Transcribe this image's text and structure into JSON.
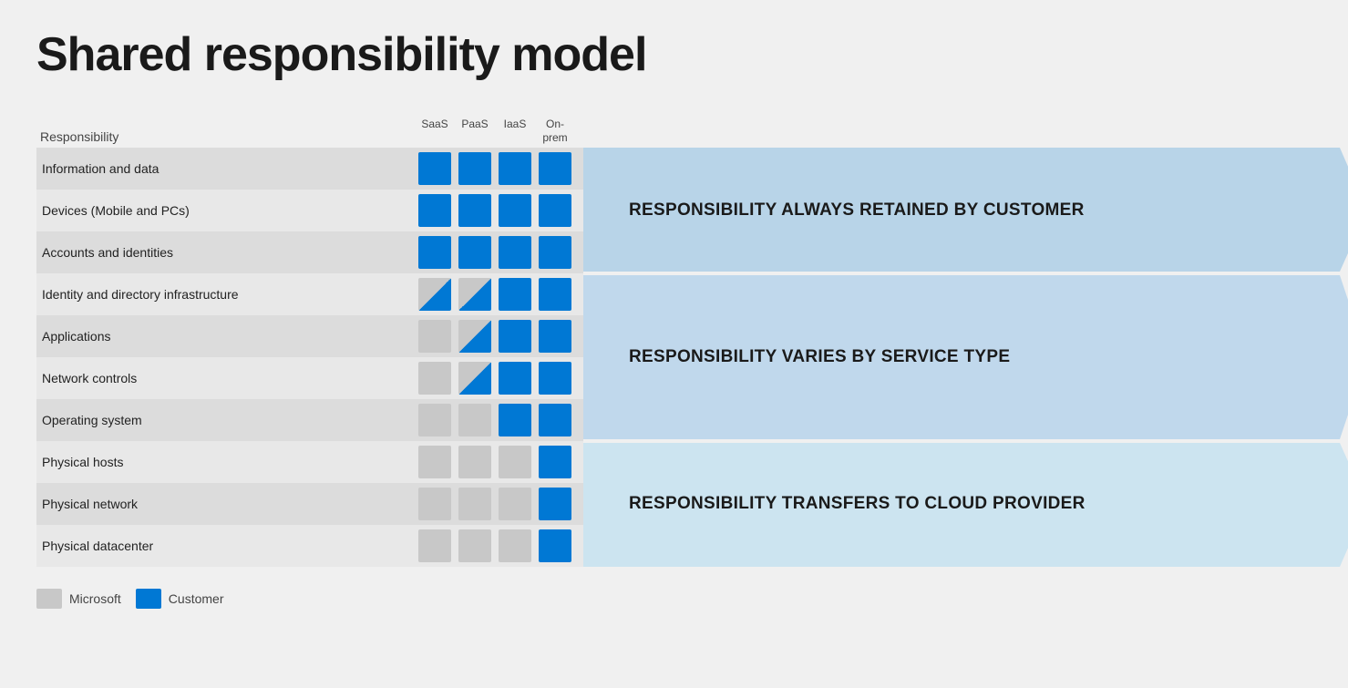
{
  "title": "Shared responsibility model",
  "table": {
    "header": {
      "responsibility_label": "Responsibility",
      "columns": [
        "SaaS",
        "PaaS",
        "IaaS",
        "On-prem"
      ]
    },
    "rows": [
      {
        "label": "Information and data",
        "cells": [
          "blue",
          "blue",
          "blue",
          "blue"
        ]
      },
      {
        "label": "Devices (Mobile and PCs)",
        "cells": [
          "blue",
          "blue",
          "blue",
          "blue"
        ]
      },
      {
        "label": "Accounts and identities",
        "cells": [
          "blue",
          "blue",
          "blue",
          "blue"
        ]
      },
      {
        "label": "Identity and directory infrastructure",
        "cells": [
          "tri-blue-br",
          "tri-blue-br",
          "blue",
          "blue"
        ]
      },
      {
        "label": "Applications",
        "cells": [
          "gray",
          "tri-blue-br",
          "blue",
          "blue"
        ]
      },
      {
        "label": "Network controls",
        "cells": [
          "gray",
          "tri-blue-br",
          "blue",
          "blue"
        ]
      },
      {
        "label": "Operating system",
        "cells": [
          "gray",
          "gray",
          "blue",
          "blue"
        ]
      },
      {
        "label": "Physical hosts",
        "cells": [
          "gray",
          "gray",
          "gray",
          "blue"
        ]
      },
      {
        "label": "Physical network",
        "cells": [
          "gray",
          "gray",
          "gray",
          "blue"
        ]
      },
      {
        "label": "Physical datacenter",
        "cells": [
          "gray",
          "gray",
          "gray",
          "blue"
        ]
      }
    ]
  },
  "arrows": [
    {
      "text": "RESPONSIBILITY ALWAYS RETAINED BY CUSTOMER",
      "row_span": 3,
      "color": "#b8d4e8"
    },
    {
      "text": "RESPONSIBILITY VARIES BY SERVICE TYPE",
      "row_span": 4,
      "color": "#c8dce8"
    },
    {
      "text": "RESPONSIBILITY TRANSFERS TO CLOUD PROVIDER",
      "row_span": 3,
      "color": "#d8e8f0"
    }
  ],
  "legend": {
    "items": [
      {
        "label": "Microsoft",
        "color": "#c8c8c8"
      },
      {
        "label": "Customer",
        "color": "#0078d4"
      }
    ]
  }
}
